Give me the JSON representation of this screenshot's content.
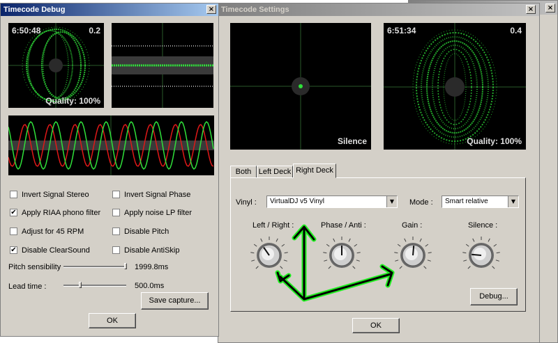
{
  "debug_window": {
    "title": "Timecode Debug",
    "close_glyph": "×",
    "scope1": {
      "time": "6:50:48",
      "value": "0.2",
      "quality": "Quality: 100%"
    },
    "checkboxes": [
      {
        "label": "Invert Signal Stereo",
        "checked": false,
        "mark": ""
      },
      {
        "label": "Invert Signal Phase",
        "checked": false,
        "mark": ""
      },
      {
        "label": "Apply RIAA phono filter",
        "checked": true,
        "mark": "✔"
      },
      {
        "label": "Apply noise LP filter",
        "checked": false,
        "mark": ""
      },
      {
        "label": "Adjust for 45 RPM",
        "checked": false,
        "mark": ""
      },
      {
        "label": "Disable Pitch",
        "checked": false,
        "mark": ""
      },
      {
        "label": "Disable ClearSound",
        "checked": true,
        "mark": "✔"
      },
      {
        "label": "Disable AntiSkip",
        "checked": false,
        "mark": ""
      }
    ],
    "pitch_sensibility": {
      "label": "Pitch sensibility",
      "value": "1999.8ms"
    },
    "lead_time": {
      "label": "Lead time :",
      "value": "500.0ms"
    },
    "save_capture_label": "Save capture...",
    "ok_label": "OK"
  },
  "settings_window": {
    "title": "Timecode Settings",
    "close_glyph": "×",
    "left_scope": {
      "status": "Silence"
    },
    "right_scope": {
      "time": "6:51:34",
      "value": "0.4",
      "quality": "Quality: 100%"
    },
    "tabs": [
      {
        "label": "Both",
        "active": false
      },
      {
        "label": "Left Deck",
        "active": false
      },
      {
        "label": "Right Deck",
        "active": true
      }
    ],
    "vinyl": {
      "label": "Vinyl :",
      "value": "VirtualDJ v5 Vinyl"
    },
    "mode": {
      "label": "Mode :",
      "value": "Smart relative"
    },
    "knobs": [
      {
        "label": "Left / Right :",
        "icon": "knob-icon"
      },
      {
        "label": "Phase / Anti :",
        "icon": "knob-icon"
      },
      {
        "label": "Gain :",
        "icon": "knob-icon"
      },
      {
        "label": "Silence :",
        "icon": "knob-icon"
      }
    ],
    "debug_label": "Debug...",
    "ok_label": "OK",
    "dropdown_glyph": "▼"
  },
  "background_window": {
    "close_glyph": "×"
  },
  "colors": {
    "scope_green": "#2fe03a",
    "scope_red": "#e01818",
    "annotation_green": "#22ee22",
    "titlebar_active": "#0a246a",
    "titlebar_inactive": "#808080"
  }
}
